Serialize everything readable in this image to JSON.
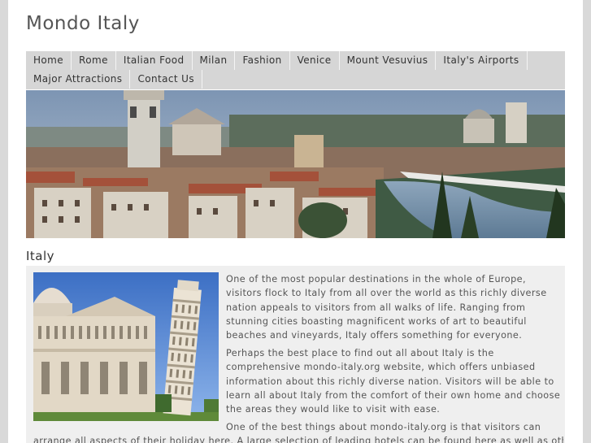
{
  "site": {
    "title": "Mondo Italy"
  },
  "nav": {
    "row1": [
      "Home",
      "Rome",
      "Italian Food",
      "Milan",
      "Fashion",
      "Venice",
      "Mount Vesuvius",
      "Italy's Airports"
    ],
    "row2": [
      "Major Attractions",
      "Contact Us"
    ]
  },
  "banner": {
    "icon": "verona-panorama-photo"
  },
  "main": {
    "heading": "Italy",
    "image_icon": "pisa-tower-photo",
    "paragraphs": [
      "One of the most popular destinations in the whole of Europe, visitors flock to Italy from all over the world as this richly diverse nation appeals to visitors from all walks of life. Ranging from stunning cities boasting magnificent works of art to beautiful beaches and vineyards, Italy offers something for everyone.",
      "Perhaps the best place to find out all about Italy is the comprehensive mondo-italy.org website, which offers unbiased information about this richly diverse nation. Visitors will be able to learn all about Italy from the comfort of their own home and choose the areas they would like to visit with ease.",
      "One of the best things about mondo-italy.org is that visitors can",
      "arrange all aspects of their holiday here. A large selection of leading hotels can be found here as well as other"
    ]
  },
  "colors": {
    "background": "#d9d9d9",
    "nav_bg": "#d6d6d6",
    "content_bg": "#efefef"
  }
}
